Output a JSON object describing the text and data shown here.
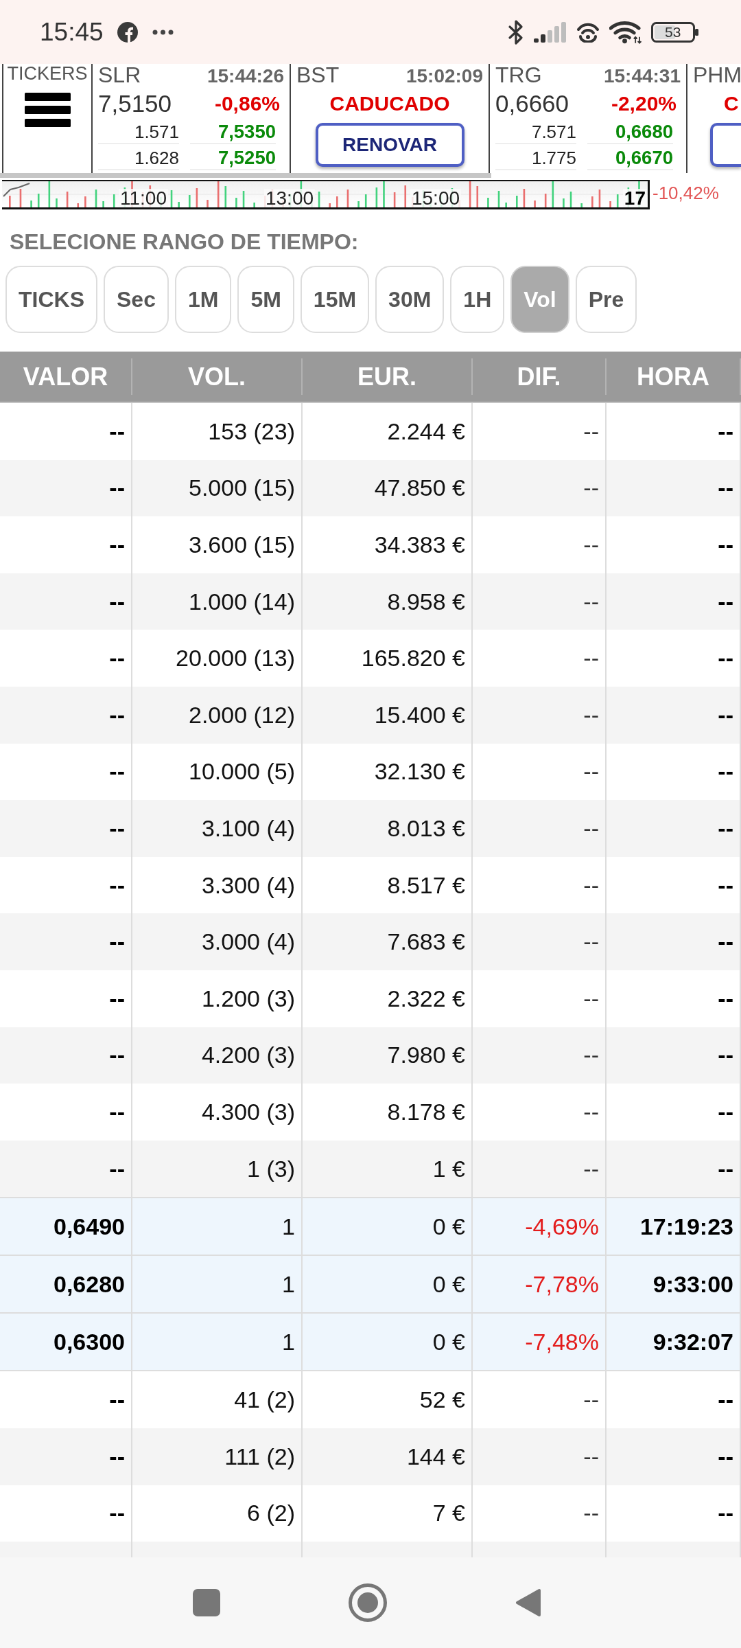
{
  "status_bar": {
    "time": "15:45",
    "battery": "53"
  },
  "tickers_bar": {
    "label": "TICKERS",
    "tickers": [
      {
        "kind": "quote",
        "symbol": "SLR",
        "time": "15:44:26",
        "price": "7,5150",
        "change": "-0,86%",
        "negative": true,
        "book": [
          {
            "volume": "1.571",
            "price": "7,5350"
          },
          {
            "volume": "1.628",
            "price": "7,5250"
          }
        ]
      },
      {
        "kind": "expired",
        "symbol": "BST",
        "time": "15:02:09",
        "status": "CADUCADO",
        "button": "RENOVAR"
      },
      {
        "kind": "quote",
        "symbol": "TRG",
        "time": "15:44:31",
        "price": "0,6660",
        "change": "-2,20%",
        "negative": true,
        "book": [
          {
            "volume": "7.571",
            "price": "0,6680"
          },
          {
            "volume": "1.775",
            "price": "0,6670"
          }
        ]
      },
      {
        "kind": "partial",
        "symbol": "PHM",
        "status": "C"
      }
    ]
  },
  "volume_strip": {
    "time_labels": [
      "11:00",
      "13:00",
      "15:00",
      "17"
    ],
    "change": "-10,42%",
    "negative": true
  },
  "time_range": {
    "title": "SELECIONE RANGO DE TIEMPO:",
    "options": [
      {
        "label": "TICKS",
        "selected": false
      },
      {
        "label": "Sec",
        "selected": false
      },
      {
        "label": "1M",
        "selected": false
      },
      {
        "label": "5M",
        "selected": false
      },
      {
        "label": "15M",
        "selected": false
      },
      {
        "label": "30M",
        "selected": false
      },
      {
        "label": "1H",
        "selected": false
      },
      {
        "label": "Vol",
        "selected": true
      },
      {
        "label": "Pre",
        "selected": false
      }
    ]
  },
  "table": {
    "columns": [
      "VALOR",
      "VOL.",
      "EUR.",
      "DIF.",
      "HORA"
    ],
    "rows": [
      {
        "cells": [
          "--",
          "153 (23)",
          "2.244 €",
          "--",
          "--"
        ],
        "highlighted": false,
        "negative": false
      },
      {
        "cells": [
          "--",
          "5.000 (15)",
          "47.850 €",
          "--",
          "--"
        ],
        "highlighted": false,
        "negative": false
      },
      {
        "cells": [
          "--",
          "3.600 (15)",
          "34.383 €",
          "--",
          "--"
        ],
        "highlighted": false,
        "negative": false
      },
      {
        "cells": [
          "--",
          "1.000 (14)",
          "8.958 €",
          "--",
          "--"
        ],
        "highlighted": false,
        "negative": false
      },
      {
        "cells": [
          "--",
          "20.000 (13)",
          "165.820 €",
          "--",
          "--"
        ],
        "highlighted": false,
        "negative": false
      },
      {
        "cells": [
          "--",
          "2.000 (12)",
          "15.400 €",
          "--",
          "--"
        ],
        "highlighted": false,
        "negative": false
      },
      {
        "cells": [
          "--",
          "10.000 (5)",
          "32.130 €",
          "--",
          "--"
        ],
        "highlighted": false,
        "negative": false
      },
      {
        "cells": [
          "--",
          "3.100 (4)",
          "8.013 €",
          "--",
          "--"
        ],
        "highlighted": false,
        "negative": false
      },
      {
        "cells": [
          "--",
          "3.300 (4)",
          "8.517 €",
          "--",
          "--"
        ],
        "highlighted": false,
        "negative": false
      },
      {
        "cells": [
          "--",
          "3.000 (4)",
          "7.683 €",
          "--",
          "--"
        ],
        "highlighted": false,
        "negative": false
      },
      {
        "cells": [
          "--",
          "1.200 (3)",
          "2.322 €",
          "--",
          "--"
        ],
        "highlighted": false,
        "negative": false
      },
      {
        "cells": [
          "--",
          "4.200 (3)",
          "7.980 €",
          "--",
          "--"
        ],
        "highlighted": false,
        "negative": false
      },
      {
        "cells": [
          "--",
          "4.300 (3)",
          "8.178 €",
          "--",
          "--"
        ],
        "highlighted": false,
        "negative": false
      },
      {
        "cells": [
          "--",
          "1 (3)",
          "1 €",
          "--",
          "--"
        ],
        "highlighted": false,
        "negative": false
      },
      {
        "cells": [
          "0,6490",
          "1",
          "0 €",
          "-4,69%",
          "17:19:23"
        ],
        "highlighted": true,
        "negative": true
      },
      {
        "cells": [
          "0,6280",
          "1",
          "0 €",
          "-7,78%",
          "9:33:00"
        ],
        "highlighted": true,
        "negative": true
      },
      {
        "cells": [
          "0,6300",
          "1",
          "0 €",
          "-7,48%",
          "9:32:07"
        ],
        "highlighted": true,
        "negative": true
      },
      {
        "cells": [
          "--",
          "41 (2)",
          "52 €",
          "--",
          "--"
        ],
        "highlighted": false,
        "negative": false
      },
      {
        "cells": [
          "--",
          "111 (2)",
          "144 €",
          "--",
          "--"
        ],
        "highlighted": false,
        "negative": false
      },
      {
        "cells": [
          "--",
          "6 (2)",
          "7 €",
          "--",
          "--"
        ],
        "highlighted": false,
        "negative": false
      }
    ]
  }
}
